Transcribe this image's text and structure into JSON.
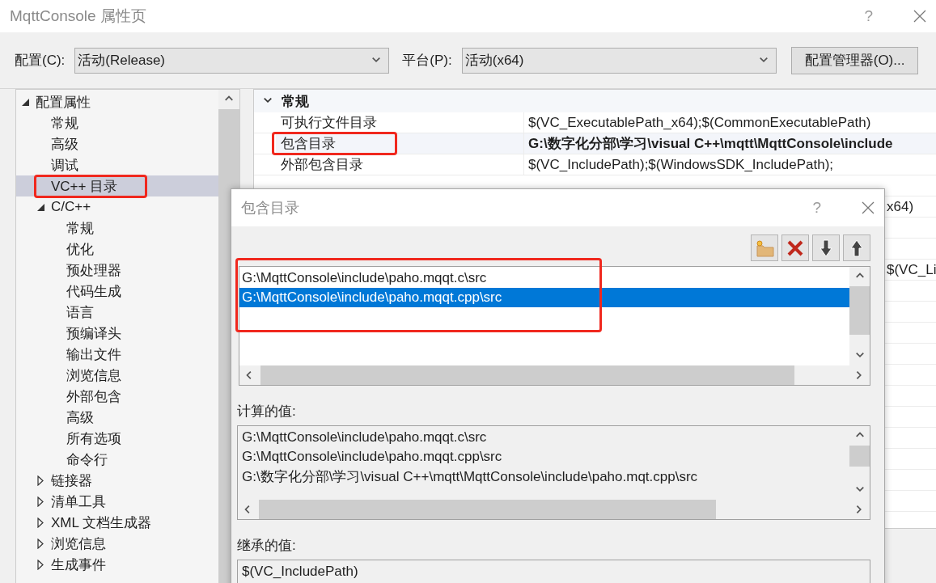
{
  "window": {
    "title": "MqttConsole 属性页",
    "help": "?"
  },
  "config": {
    "label": "配置(C):",
    "value": "活动(Release)"
  },
  "platform": {
    "label": "平台(P):",
    "value": "活动(x64)"
  },
  "config_manager_button": "配置管理器(O)...",
  "tree": [
    {
      "label": "配置属性",
      "expanded": true,
      "selected": false,
      "children": [
        {
          "label": "常规",
          "selected": false
        },
        {
          "label": "高级",
          "selected": false
        },
        {
          "label": "调试",
          "selected": false
        },
        {
          "label": "VC++ 目录",
          "selected": true,
          "annotated": true
        },
        {
          "label": "C/C++",
          "expanded": true,
          "selected": false,
          "children": [
            {
              "label": "常规",
              "selected": false
            },
            {
              "label": "优化",
              "selected": false
            },
            {
              "label": "预处理器",
              "selected": false
            },
            {
              "label": "代码生成",
              "selected": false
            },
            {
              "label": "语言",
              "selected": false
            },
            {
              "label": "预编译头",
              "selected": false
            },
            {
              "label": "输出文件",
              "selected": false
            },
            {
              "label": "浏览信息",
              "selected": false
            },
            {
              "label": "外部包含",
              "selected": false
            },
            {
              "label": "高级",
              "selected": false
            },
            {
              "label": "所有选项",
              "selected": false
            },
            {
              "label": "命令行",
              "selected": false
            }
          ]
        },
        {
          "label": "链接器",
          "expanded": false,
          "selected": false
        },
        {
          "label": "清单工具",
          "expanded": false,
          "selected": false
        },
        {
          "label": "XML 文档生成器",
          "expanded": false,
          "selected": false
        },
        {
          "label": "浏览信息",
          "expanded": false,
          "selected": false
        },
        {
          "label": "生成事件",
          "expanded": false,
          "selected": false
        }
      ]
    }
  ],
  "property_grid": {
    "category": "常规",
    "expanded": true,
    "rows": [
      {
        "kind": "full",
        "name": "可执行文件目录",
        "value": "$(VC_ExecutablePath_x64);$(CommonExecutablePath)",
        "selected": false,
        "modified": false
      },
      {
        "kind": "full",
        "name": "包含目录",
        "value": "G:\\数字化分部\\学习\\visual C++\\mqtt\\MqttConsole\\include",
        "selected": true,
        "modified": true,
        "annotated": true
      },
      {
        "kind": "full",
        "name": "外部包含目录",
        "value": "$(VC_IncludePath);$(WindowsSDK_IncludePath);",
        "selected": false,
        "modified": false
      },
      {
        "kind": "covered"
      },
      {
        "kind": "covered",
        "value": "x64)"
      },
      {
        "kind": "covered"
      },
      {
        "kind": "covered"
      },
      {
        "kind": "covered",
        "value": "$(VC_Li"
      }
    ]
  },
  "dialog": {
    "title": "包含目录",
    "help": "?",
    "entries": [
      {
        "text": "G:\\MqttConsole\\include\\paho.mqqt.c\\src",
        "selected": false
      },
      {
        "text": "G:\\MqttConsole\\include\\paho.mqqt.cpp\\src",
        "selected": true
      }
    ],
    "entries_annotated": true,
    "computed_label": "计算的值:",
    "computed": [
      "G:\\MqttConsole\\include\\paho.mqqt.c\\src",
      "G:\\MqttConsole\\include\\paho.mqqt.cpp\\src",
      "G:\\数字化分部\\学习\\visual C++\\mqtt\\MqttConsole\\include\\paho.mqt.cpp\\src"
    ],
    "inherited_label": "继承的值:",
    "inherited": [
      "$(VC_IncludePath)"
    ]
  }
}
